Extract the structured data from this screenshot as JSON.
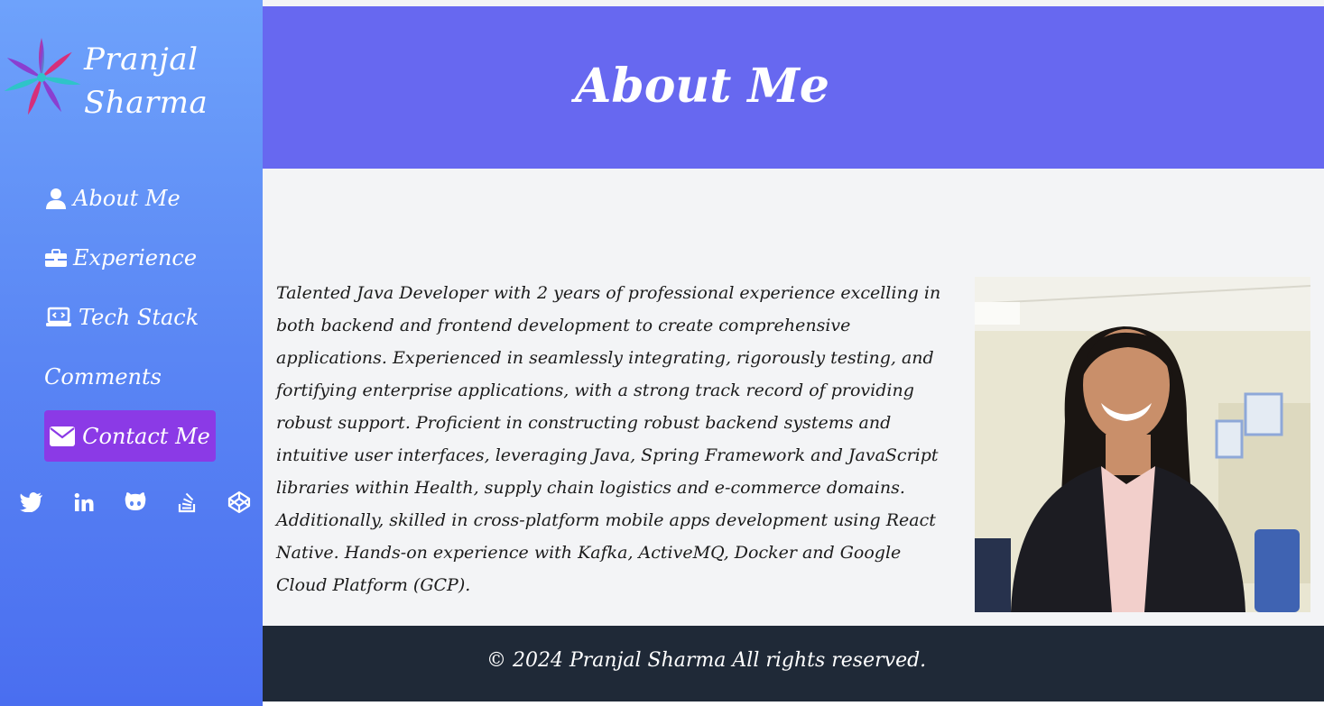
{
  "sidebar": {
    "brand_name": "Pranjal Sharma",
    "nav": [
      {
        "label": "About Me",
        "icon": "user-icon"
      },
      {
        "label": "Experience",
        "icon": "briefcase-icon"
      },
      {
        "label": "Tech Stack",
        "icon": "laptop-code-icon"
      },
      {
        "label": "Comments",
        "icon": ""
      }
    ],
    "contact_label": "Contact Me",
    "social": [
      "twitter-icon",
      "linkedin-icon",
      "github-icon",
      "stackoverflow-icon",
      "codepen-icon"
    ]
  },
  "main": {
    "title": "About Me",
    "bio": "Talented Java Developer with 2 years of professional experience excelling in both backend and frontend development to create comprehensive applications. Experienced in seamlessly integrating, rigorously testing, and fortifying enterprise applications, with a strong track record of providing robust support. Proficient in constructing robust backend systems and intuitive user interfaces, leveraging Java, Spring Framework and JavaScript libraries within Health, supply chain logistics and e-commerce domains. Additionally, skilled in cross-platform mobile apps development using React Native. Hands-on experience with Kafka, ActiveMQ, Docker and Google Cloud Platform (GCP)."
  },
  "footer": {
    "text": "© 2024 Pranjal Sharma All rights reserved."
  },
  "colors": {
    "sidebar_top": "#6ea2fb",
    "sidebar_bottom": "#4a6ef0",
    "header": "#6768f0",
    "contact_button": "#8b3ae6",
    "content_bg": "#f3f4f6",
    "footer_bg": "#1f2937"
  }
}
